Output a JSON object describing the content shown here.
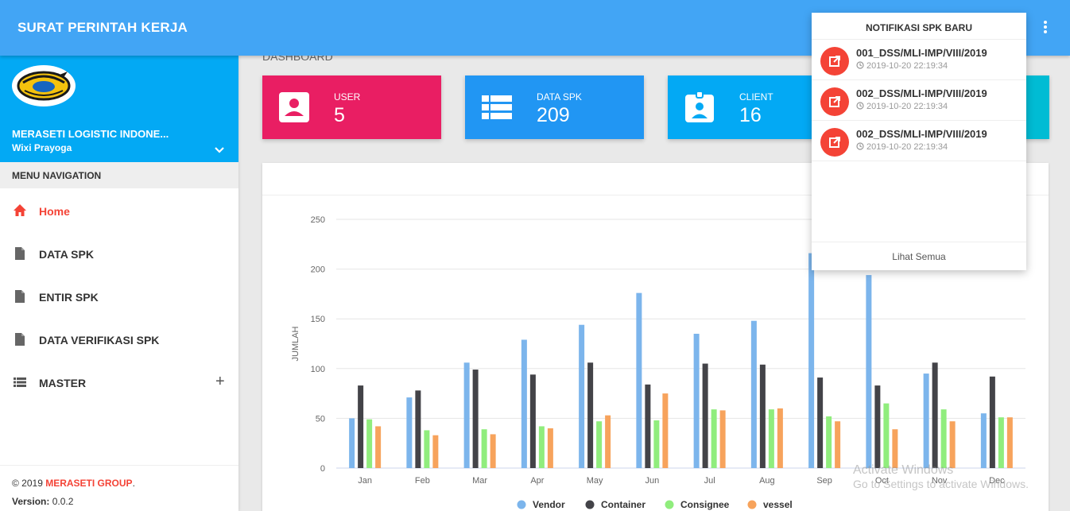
{
  "app": {
    "title": "SURAT PERINTAH KERJA"
  },
  "sidebar": {
    "company": "MERASETI LOGISTIC INDONE...",
    "username": "Wixi Prayoga",
    "menu_header": "MENU NAVIGATION",
    "items": [
      {
        "label": "Home",
        "icon": "home-icon",
        "active": true
      },
      {
        "label": "DATA SPK",
        "icon": "file-icon"
      },
      {
        "label": "ENTIR SPK",
        "icon": "file-icon"
      },
      {
        "label": "DATA VERIFIKASI SPK",
        "icon": "file-icon"
      },
      {
        "label": "MASTER",
        "icon": "list-icon",
        "expand": "+"
      }
    ],
    "footer": {
      "copyright": "© 2019 ",
      "brand": "MERASETI GROUP",
      "dot": ".",
      "version_label": "Version:",
      "version": "0.0.2"
    }
  },
  "dashboard": {
    "title": "DASHBOARD",
    "boxes": [
      {
        "label": "USER",
        "value": "5",
        "color": "#e91e63",
        "icon": "user-card-icon"
      },
      {
        "label": "DATA SPK",
        "value": "209",
        "color": "#2196f3",
        "icon": "list-icon"
      },
      {
        "label": "CLIENT",
        "value": "16",
        "color": "#03a9f4",
        "icon": "badge-icon"
      }
    ],
    "extra_box_color": "#00bcd4"
  },
  "notifications": {
    "header": "NOTIFIKASI SPK BARU",
    "items": [
      {
        "title": "001_DSS/MLI-IMP/VIII/2019",
        "time": "2019-10-20 22:19:34"
      },
      {
        "title": "002_DSS/MLI-IMP/VIII/2019",
        "time": "2019-10-20 22:19:34"
      },
      {
        "title": "002_DSS/MLI-IMP/VIII/2019",
        "time": "2019-10-20 22:19:34"
      }
    ],
    "footer": "Lihat Semua"
  },
  "watermark": {
    "line1": "Activate Windows",
    "line2": "Go to Settings to activate Windows."
  },
  "chart_data": {
    "type": "bar",
    "ylabel": "JUMLAH",
    "ylim": [
      0,
      250
    ],
    "yticks": [
      0,
      50,
      100,
      150,
      200,
      250
    ],
    "grid": true,
    "legend": "bottom",
    "categories": [
      "Jan",
      "Feb",
      "Mar",
      "Apr",
      "May",
      "Jun",
      "Jul",
      "Aug",
      "Sep",
      "Oct",
      "Nov",
      "Dec"
    ],
    "series": [
      {
        "name": "Vendor",
        "color": "#7cb5ec",
        "values": [
          50,
          71,
          106,
          129,
          144,
          176,
          135,
          148,
          216,
          194,
          95,
          55
        ]
      },
      {
        "name": "Container",
        "color": "#434348",
        "values": [
          83,
          78,
          99,
          94,
          106,
          84,
          105,
          104,
          91,
          83,
          106,
          92
        ]
      },
      {
        "name": "Consignee",
        "color": "#90ed7d",
        "values": [
          49,
          38,
          39,
          42,
          47,
          48,
          59,
          59,
          52,
          65,
          59,
          51
        ]
      },
      {
        "name": "vessel",
        "color": "#f7a35c",
        "values": [
          42,
          33,
          34,
          40,
          53,
          75,
          58,
          60,
          47,
          39,
          47,
          51
        ]
      }
    ]
  }
}
